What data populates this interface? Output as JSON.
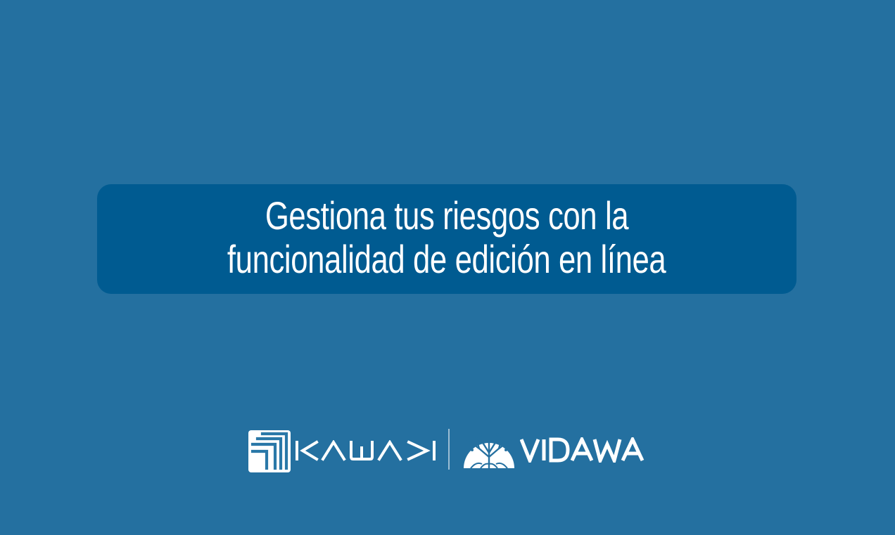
{
  "colors": {
    "page_background": "#2470a0",
    "banner_background": "#005b91",
    "text": "#ffffff",
    "kawak_emblem_fill": "#ffffff",
    "kawak_emblem_lines": "#2a78a8"
  },
  "banner": {
    "headline_line_1": "Gestiona tus riesgos con la",
    "headline_line_2": "funcionalidad de edición en línea"
  },
  "logos": {
    "kawak": {
      "icon": "kawak-emblem-icon",
      "wordmark": "KAWAK"
    },
    "vidawa": {
      "icon": "tree-circle-icon",
      "wordmark": "VIDAWA"
    }
  }
}
